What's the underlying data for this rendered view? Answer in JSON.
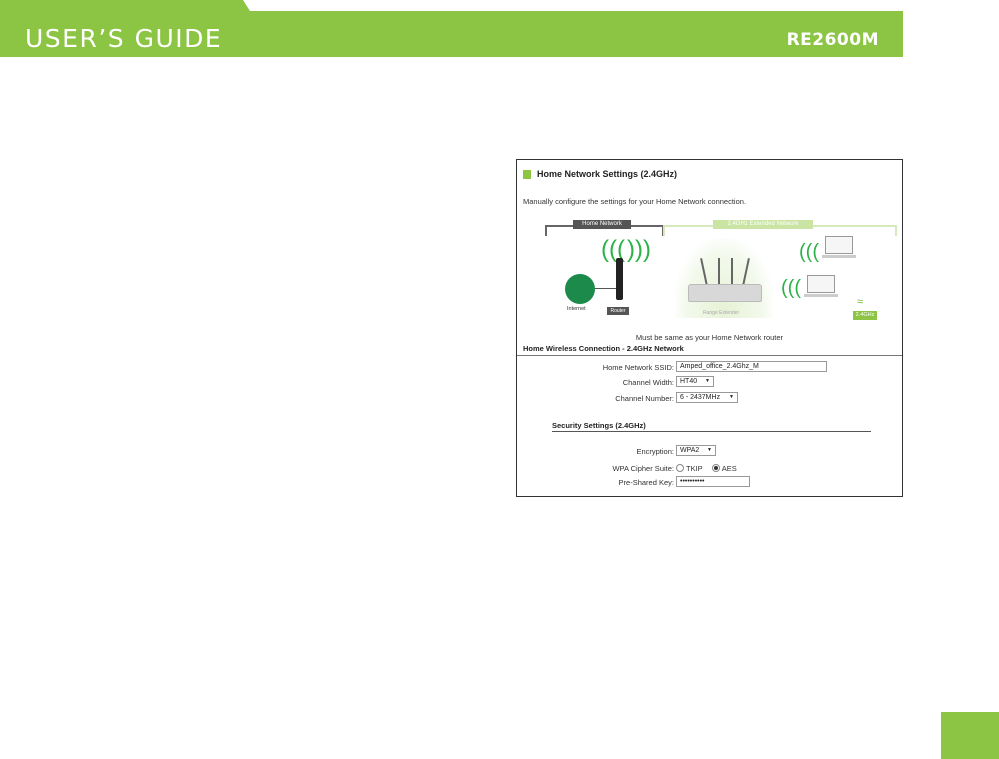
{
  "header": {
    "guide_title": "USER’S GUIDE",
    "model": "RE2600M",
    "color": "#8cc443"
  },
  "panel": {
    "title": "Home Network Settings (2.4GHz)",
    "description": "Manually configure the settings for your Home Network connection.",
    "diagram": {
      "home_network_label": "Home Network",
      "extended_network_label": "2.4GHz Extended Network",
      "internet_label": "Internet",
      "router_label": "Router",
      "extender_label": "Range Extender",
      "band_badge": "2.4GHz"
    },
    "note": "Must be same as your Home Network router",
    "wireless_section": {
      "heading": "Home Wireless Connection - 2.4GHz Network",
      "ssid_label": "Home Network SSID:",
      "ssid_value": "Amped_office_2.4Ghz_M",
      "channel_width_label": "Channel Width:",
      "channel_width_value": "HT40",
      "channel_number_label": "Channel Number:",
      "channel_number_value": "6 - 2437MHz"
    },
    "security_section": {
      "heading": "Security Settings (2.4GHz)",
      "encryption_label": "Encryption:",
      "encryption_value": "WPA2",
      "cipher_label": "WPA Cipher Suite:",
      "cipher_options": [
        "TKIP",
        "AES"
      ],
      "cipher_selected": "AES",
      "psk_label": "Pre-Shared Key:",
      "psk_value": "••••••••••",
      "show_key_icon": "eye-icon"
    }
  }
}
